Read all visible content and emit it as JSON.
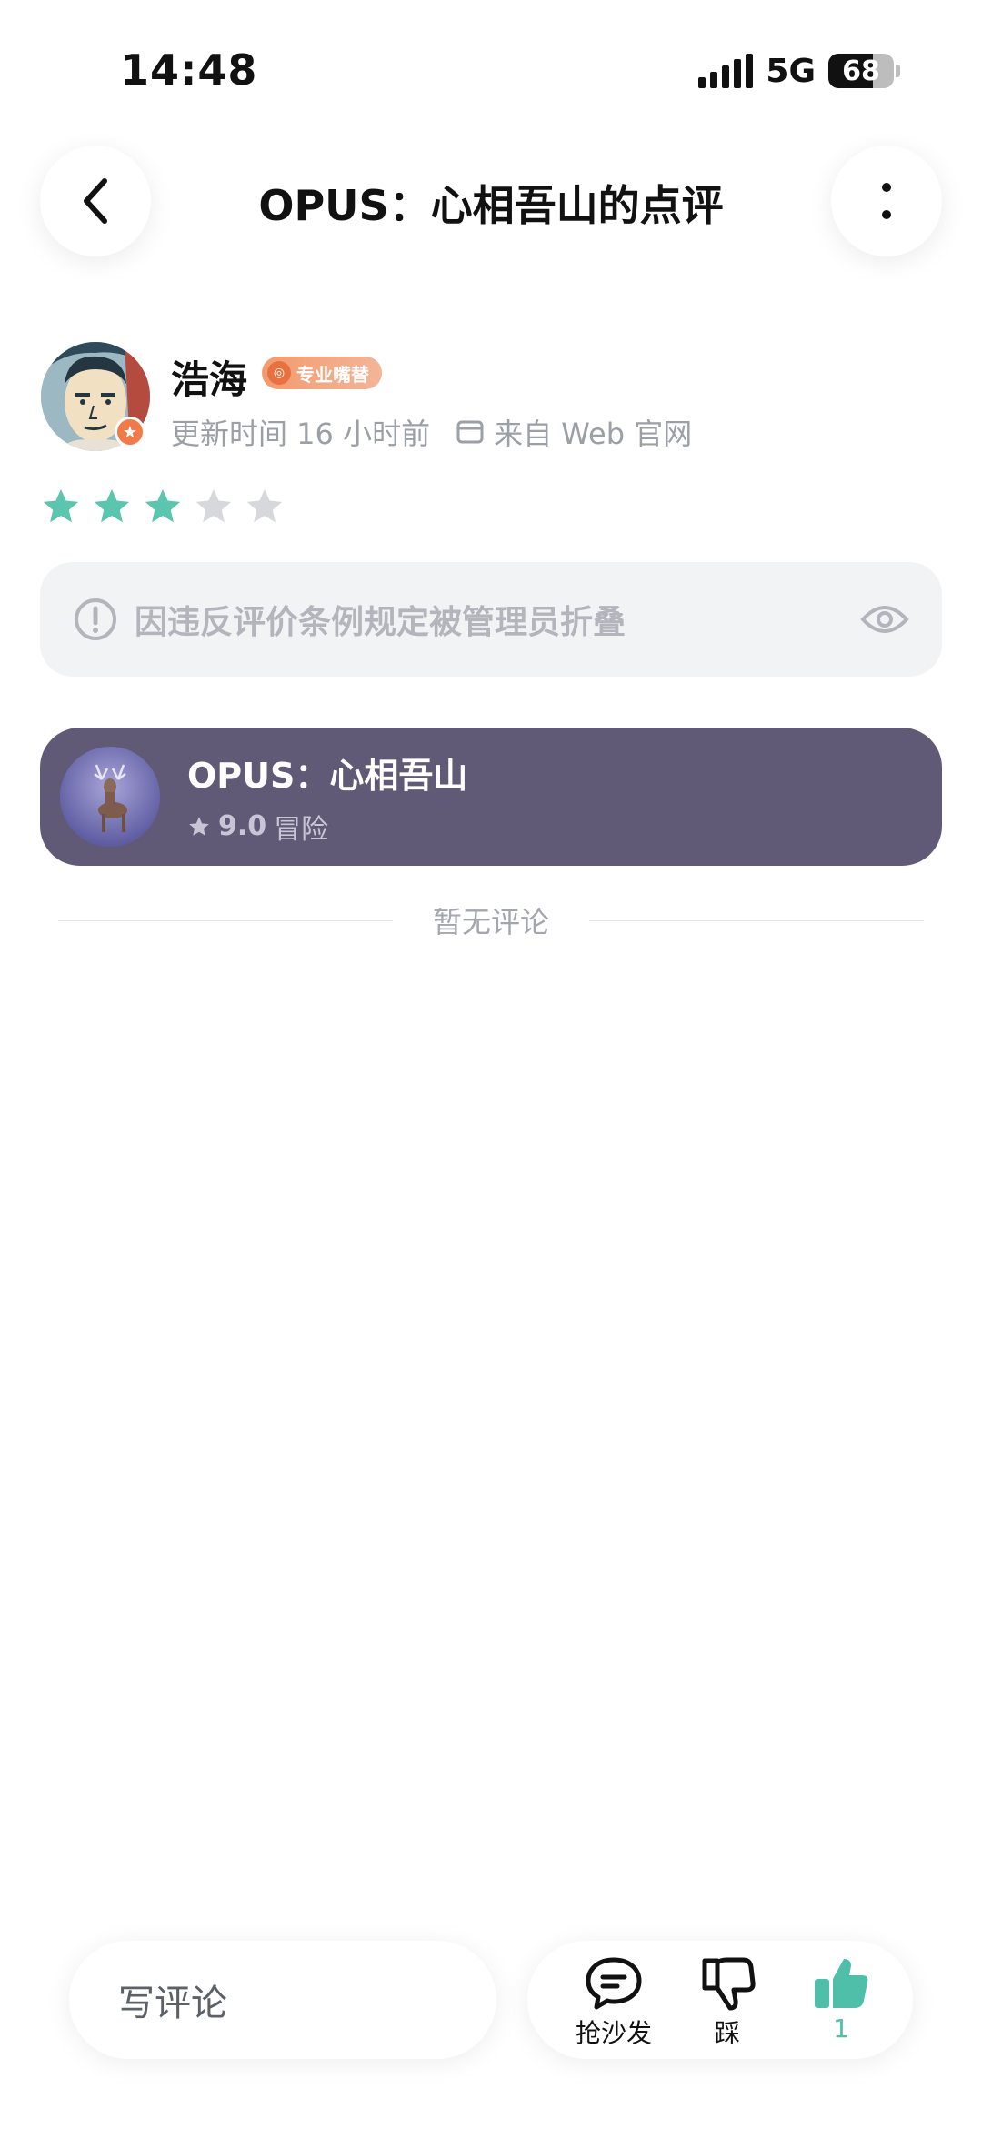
{
  "status_bar": {
    "time": "14:48",
    "network": "5G",
    "battery": "68",
    "battery_level": 0.68
  },
  "header": {
    "title": "OPUS：心相吾山的点评",
    "back_icon": "chevron-left-icon",
    "more_icon": "more-vertical-icon"
  },
  "review": {
    "user_name": "浩海",
    "badge": "专业嘴替",
    "updated": "更新时间 16 小时前",
    "source": "来自 Web 官网",
    "rating": 3,
    "rating_max": 5,
    "star_color": "#5cc5ad",
    "folded_notice": "因违反评价条例规定被管理员折叠"
  },
  "game": {
    "title": "OPUS：心相吾山",
    "score": "9.0",
    "genre": "冒险",
    "card_color": "#605a76"
  },
  "comments": {
    "empty_text": "暂无评论"
  },
  "bottom_bar": {
    "input_placeholder": "写评论",
    "sofa_label": "抢沙发",
    "dislike_label": "踩",
    "like_count": "1",
    "like_color": "#4fbfa9"
  }
}
